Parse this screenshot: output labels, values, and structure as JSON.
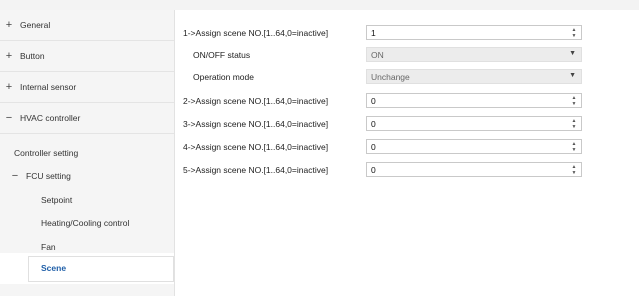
{
  "sidebar": {
    "items": [
      {
        "sign": "+",
        "label": "General"
      },
      {
        "sign": "+",
        "label": "Button"
      },
      {
        "sign": "+",
        "label": "Internal sensor"
      },
      {
        "sign": "−",
        "label": "HVAC controller"
      },
      {
        "sign": "",
        "label": "Controller setting"
      },
      {
        "sign": "−",
        "label": "FCU setting"
      },
      {
        "sign": "",
        "label": "Setpoint"
      },
      {
        "sign": "",
        "label": "Heating/Cooling control"
      },
      {
        "sign": "",
        "label": "Fan"
      },
      {
        "sign": "",
        "label": "Scene"
      }
    ]
  },
  "params": [
    {
      "label": "1->Assign scene NO.[1..64,0=inactive]",
      "type": "spin",
      "value": "1"
    },
    {
      "label": "ON/OFF status",
      "type": "select",
      "value": "ON"
    },
    {
      "label": "Operation mode",
      "type": "select",
      "value": "Unchange"
    },
    {
      "label": "2->Assign scene NO.[1..64,0=inactive]",
      "type": "spin",
      "value": "0"
    },
    {
      "label": "3->Assign scene NO.[1..64,0=inactive]",
      "type": "spin",
      "value": "0"
    },
    {
      "label": "4->Assign scene NO.[1..64,0=inactive]",
      "type": "spin",
      "value": "0"
    },
    {
      "label": "5->Assign scene NO.[1..64,0=inactive]",
      "type": "spin",
      "value": "0"
    }
  ],
  "icons": {
    "spin": "spin-arrows-icon",
    "dropdown": "chevron-down-icon"
  },
  "colors": {
    "active_text": "#1f5fa8",
    "sidebar_bg": "#f5f5f5"
  }
}
